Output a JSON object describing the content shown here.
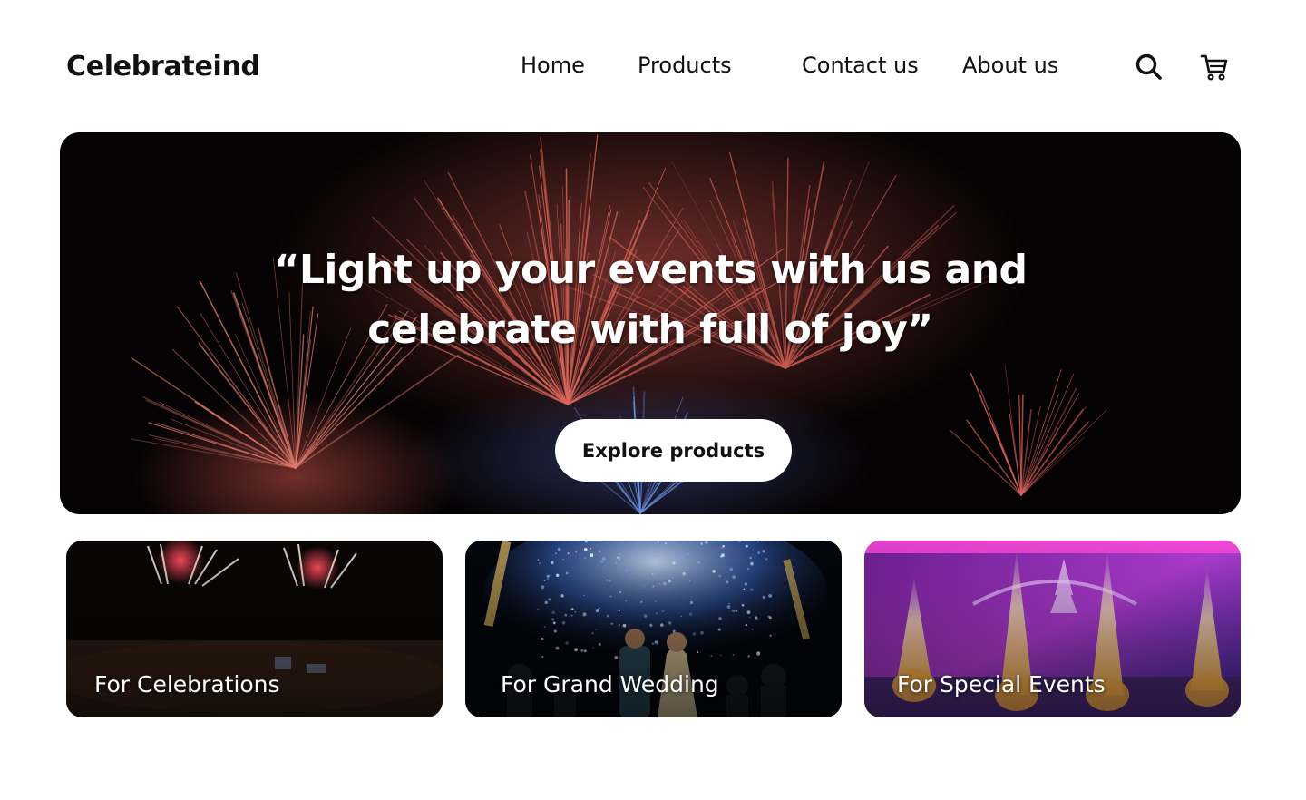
{
  "brand": {
    "name": "Celebrateind"
  },
  "nav": {
    "items": [
      {
        "label": "Home"
      },
      {
        "label": "Products"
      },
      {
        "label": "Contact us"
      },
      {
        "label": "About us"
      }
    ],
    "icons": [
      "search-icon",
      "cart-icon"
    ]
  },
  "hero": {
    "quote_line1": "“Light up your events with us and",
    "quote_line2": "celebrate with full of joy”",
    "cta_label": "Explore products"
  },
  "categories": [
    {
      "label": "For Celebrations"
    },
    {
      "label": "For Grand Wedding"
    },
    {
      "label": "For Special Events"
    }
  ],
  "colors": {
    "text": "#111111",
    "background": "#ffffff",
    "hero_bg": "#050203",
    "firework_red": "#e0584d",
    "firework_blue": "#7fb3ff",
    "event_purple": "#b23cd6"
  }
}
